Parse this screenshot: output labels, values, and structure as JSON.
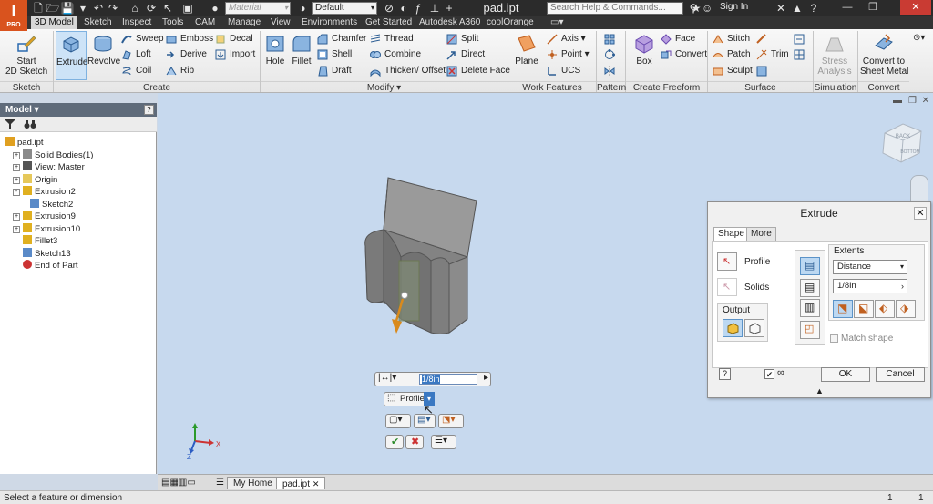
{
  "app": {
    "logo": "I",
    "logo_sub": "PRO",
    "doc_title": "pad.ipt"
  },
  "titlebar": {
    "material_placeholder": "Material",
    "appearance_value": "Default",
    "help_search_placeholder": "Search Help & Commands...",
    "sign_in": "Sign In"
  },
  "menu_tabs": [
    "3D Model",
    "Sketch",
    "Inspect",
    "Tools",
    "CAM",
    "Manage",
    "View",
    "Environments",
    "Get Started",
    "Autodesk A360",
    "coolOrange"
  ],
  "active_menu_tab": "3D Model",
  "ribbon": {
    "panels": [
      "Sketch",
      "Create",
      "Modify",
      "Work Features",
      "Pattern",
      "Create Freeform",
      "Surface",
      "Simulation",
      "Convert"
    ],
    "sketch": {
      "start_2d_sketch": "Start\n2D Sketch"
    },
    "create": {
      "extrude": "Extrude",
      "revolve": "Revolve",
      "sweep": "Sweep",
      "loft": "Loft",
      "coil": "Coil",
      "emboss": "Emboss",
      "derive": "Derive",
      "rib": "Rib",
      "decal": "Decal",
      "import": "Import"
    },
    "modify": {
      "hole": "Hole",
      "fillet": "Fillet",
      "chamfer": "Chamfer",
      "shell": "Shell",
      "draft": "Draft",
      "thread": "Thread",
      "combine": "Combine",
      "thicken_offset": "Thicken/ Offset",
      "split": "Split",
      "direct": "Direct",
      "delete_face": "Delete Face"
    },
    "work_features": {
      "plane": "Plane",
      "axis": "Axis",
      "point": "Point",
      "ucs": "UCS"
    },
    "freeform": {
      "box": "Box",
      "face": "Face",
      "convert": "Convert"
    },
    "surface": {
      "stitch": "Stitch",
      "patch": "Patch",
      "trim": "Trim",
      "sculpt": "Sculpt"
    },
    "simulation": {
      "stress_analysis": "Stress\nAnalysis"
    },
    "convert": {
      "convert_to_sheet_metal": "Convert to\nSheet Metal"
    }
  },
  "browser": {
    "title": "Model",
    "help": "?",
    "tree": [
      {
        "label": "pad.ipt",
        "indent": 0,
        "expander": "",
        "icon": "part-icon"
      },
      {
        "label": "Solid Bodies(1)",
        "indent": 1,
        "expander": "+",
        "icon": "solid-bodies-icon"
      },
      {
        "label": "View: Master",
        "indent": 1,
        "expander": "+",
        "icon": "view-icon"
      },
      {
        "label": "Origin",
        "indent": 1,
        "expander": "+",
        "icon": "folder-icon"
      },
      {
        "label": "Extrusion2",
        "indent": 1,
        "expander": "-",
        "icon": "extrusion-icon"
      },
      {
        "label": "Sketch2",
        "indent": 2,
        "expander": "",
        "icon": "sketch-icon"
      },
      {
        "label": "Extrusion9",
        "indent": 1,
        "expander": "+",
        "icon": "extrusion-icon"
      },
      {
        "label": "Extrusion10",
        "indent": 1,
        "expander": "+",
        "icon": "extrusion-icon"
      },
      {
        "label": "Fillet3",
        "indent": 1,
        "expander": "",
        "icon": "fillet-icon"
      },
      {
        "label": "Sketch13",
        "indent": 1,
        "expander": "",
        "icon": "sketch-icon"
      },
      {
        "label": "End of Part",
        "indent": 1,
        "expander": "",
        "icon": "end-of-part-icon"
      }
    ]
  },
  "viewcube": {
    "face_top": "BACK",
    "face_side": "BOTTOM"
  },
  "minitoolbar": {
    "distance_value": "1/8in",
    "profile_label": "Profile"
  },
  "triad": {
    "x": "X",
    "z": "Z"
  },
  "dialog": {
    "title": "Extrude",
    "tabs": [
      "Shape",
      "More"
    ],
    "active_tab": "Shape",
    "profile_label": "Profile",
    "solids_label": "Solids",
    "output_label": "Output",
    "extents_label": "Extents",
    "extents_value": "Distance",
    "distance_value": "1/8in",
    "match_shape_label": "Match shape",
    "ok_label": "OK",
    "cancel_label": "Cancel",
    "help": "?"
  },
  "bottom_tabs": [
    "My Home",
    "pad.ipt"
  ],
  "active_bottom_tab": "pad.ipt",
  "status": {
    "message": "Select a feature or dimension",
    "count_a": "1",
    "count_b": "1"
  },
  "colors": {
    "accent": "#d9531e",
    "viewport_bg": "#c7d9ee",
    "part_gray": "#8f8f8f",
    "selection_blue": "#cde3f7",
    "extrude_arrow": "#d98a1c"
  }
}
